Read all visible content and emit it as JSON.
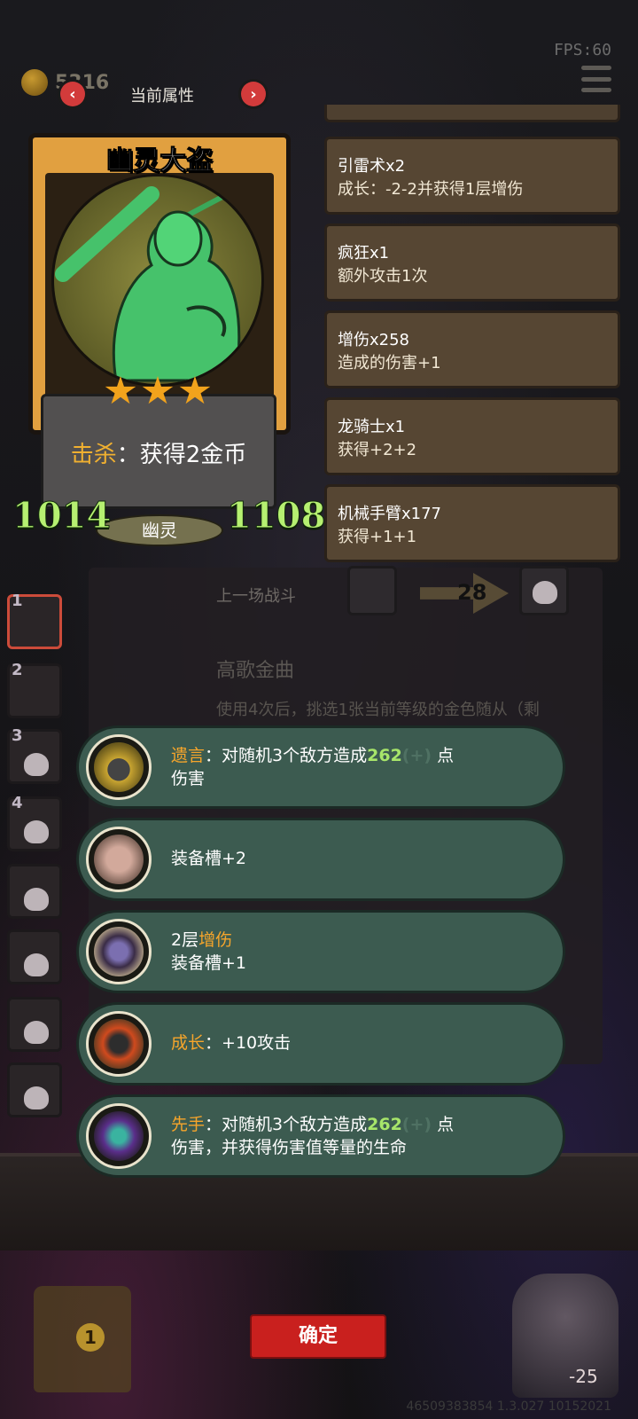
{
  "topbar": {
    "fps": "FPS:60",
    "gold": "5316",
    "tab_title": "当前属性",
    "prev_glyph": "‹",
    "next_glyph": "›"
  },
  "card": {
    "name": "幽灵大盗",
    "stars": 3,
    "kill_label": "击杀",
    "kill_sep": "：",
    "kill_effect": "获得2金币",
    "attack": "1014",
    "health": "1108",
    "tribe": "幽灵"
  },
  "buffs": [
    {
      "title": "引雷术x2",
      "desc": "成长：-2-2并获得1层增伤"
    },
    {
      "title": "疯狂x1",
      "desc": "额外攻击1次"
    },
    {
      "title": "增伤x258",
      "desc": "造成的伤害+1"
    },
    {
      "title": "龙骑士x1",
      "desc": "获得+2+2"
    },
    {
      "title": "机械手臂x177",
      "desc": "获得+1+1"
    }
  ],
  "history": {
    "label": "上一场战斗",
    "damage": "28"
  },
  "song": {
    "title": "高歌金曲",
    "desc": "使用4次后，挑选1张当前等级的金色随从（剩"
  },
  "roster": [
    "1",
    "2",
    "3",
    "4"
  ],
  "abilities": [
    {
      "keyword": "遗言",
      "sep": "：",
      "pre": "对随机3个敌方造成",
      "num": "262",
      "faded": "(+)",
      "post": "点",
      "line2": "伤害"
    },
    {
      "line1": "装备槽+2"
    },
    {
      "pre": "2层",
      "keyword": "增伤",
      "line2": "装备槽+1"
    },
    {
      "keyword": "成长",
      "sep": "：",
      "post": "+10攻击"
    },
    {
      "keyword": "先手",
      "sep": "：",
      "pre": "对随机3个敌方造成",
      "num": "262",
      "faded": "(+)",
      "post": "点",
      "line2": "伤害，并获得伤害值等量的生命"
    }
  ],
  "footer": {
    "confirm": "确定",
    "chest_count": "1",
    "hero_hp": "-25",
    "version": "46509383854 1.3.027 10152021"
  },
  "colors": {
    "card_frame": "#e1a040",
    "buff_bg": "#564633",
    "ability_bg": "#3c5b50",
    "keyword": "#f6a52b",
    "number": "#a7e56a",
    "stat": "#b6f071",
    "confirm": "#c9201e"
  },
  "icons": [
    "coin-icon",
    "menu-icon",
    "ghost-thief-portrait",
    "star-icon",
    "bomb-icon",
    "pig-icon",
    "gauntlet-icon",
    "axe-icon",
    "dagger-icon",
    "skull-icon",
    "chest-icon"
  ]
}
